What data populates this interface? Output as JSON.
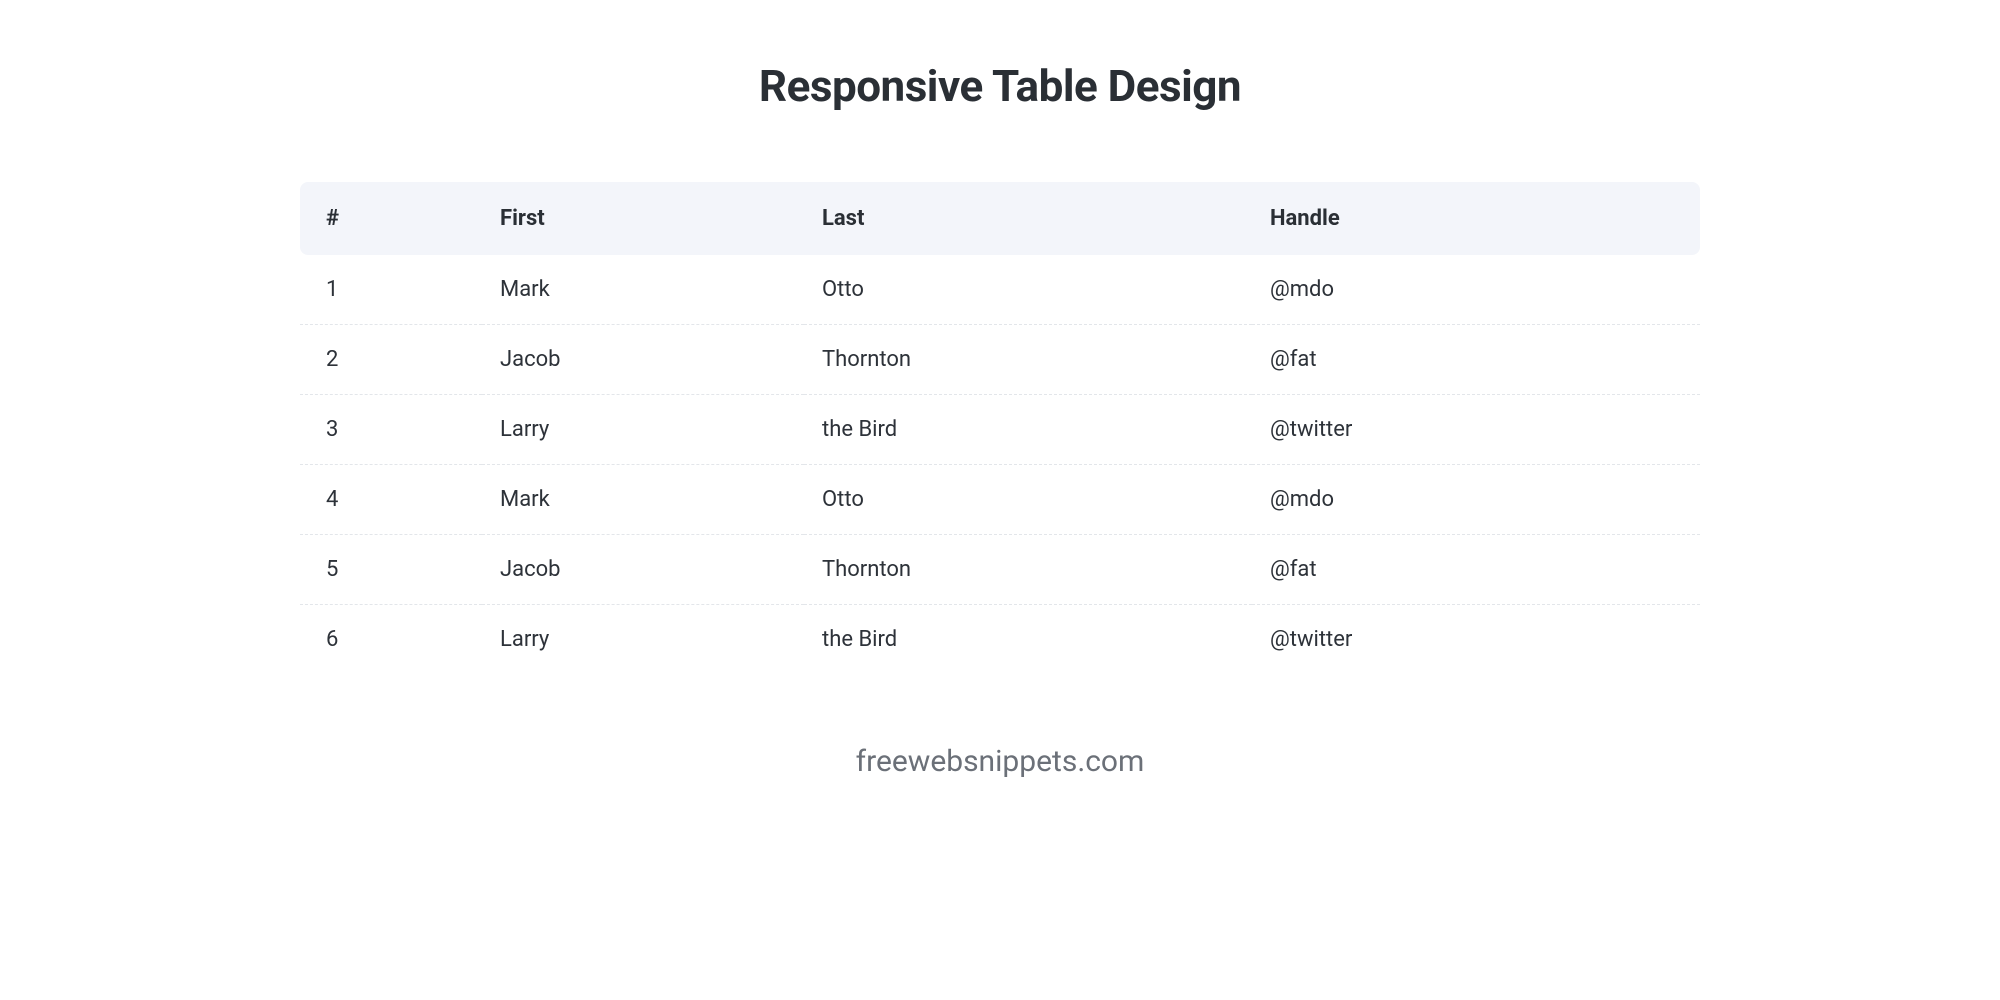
{
  "title": "Responsive Table Design",
  "table": {
    "headers": {
      "id": "#",
      "first": "First",
      "last": "Last",
      "handle": "Handle"
    },
    "rows": [
      {
        "id": "1",
        "first": "Mark",
        "last": "Otto",
        "handle": "@mdo"
      },
      {
        "id": "2",
        "first": "Jacob",
        "last": "Thornton",
        "handle": "@fat"
      },
      {
        "id": "3",
        "first": "Larry",
        "last": "the Bird",
        "handle": "@twitter"
      },
      {
        "id": "4",
        "first": "Mark",
        "last": "Otto",
        "handle": "@mdo"
      },
      {
        "id": "5",
        "first": "Jacob",
        "last": "Thornton",
        "handle": "@fat"
      },
      {
        "id": "6",
        "first": "Larry",
        "last": "the Bird",
        "handle": "@twitter"
      }
    ]
  },
  "footer": "freewebsnippets.com"
}
